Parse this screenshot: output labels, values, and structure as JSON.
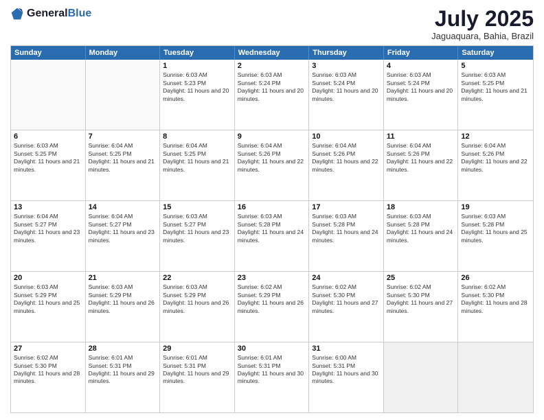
{
  "header": {
    "logo_general": "General",
    "logo_blue": "Blue",
    "month": "July 2025",
    "location": "Jaguaquara, Bahia, Brazil"
  },
  "day_headers": [
    "Sunday",
    "Monday",
    "Tuesday",
    "Wednesday",
    "Thursday",
    "Friday",
    "Saturday"
  ],
  "weeks": [
    [
      {
        "day": "",
        "info": "",
        "empty": true
      },
      {
        "day": "",
        "info": "",
        "empty": true
      },
      {
        "day": "1",
        "info": "Sunrise: 6:03 AM\nSunset: 5:23 PM\nDaylight: 11 hours and 20 minutes."
      },
      {
        "day": "2",
        "info": "Sunrise: 6:03 AM\nSunset: 5:24 PM\nDaylight: 11 hours and 20 minutes."
      },
      {
        "day": "3",
        "info": "Sunrise: 6:03 AM\nSunset: 5:24 PM\nDaylight: 11 hours and 20 minutes."
      },
      {
        "day": "4",
        "info": "Sunrise: 6:03 AM\nSunset: 5:24 PM\nDaylight: 11 hours and 20 minutes."
      },
      {
        "day": "5",
        "info": "Sunrise: 6:03 AM\nSunset: 5:25 PM\nDaylight: 11 hours and 21 minutes."
      }
    ],
    [
      {
        "day": "6",
        "info": "Sunrise: 6:03 AM\nSunset: 5:25 PM\nDaylight: 11 hours and 21 minutes."
      },
      {
        "day": "7",
        "info": "Sunrise: 6:04 AM\nSunset: 5:25 PM\nDaylight: 11 hours and 21 minutes."
      },
      {
        "day": "8",
        "info": "Sunrise: 6:04 AM\nSunset: 5:25 PM\nDaylight: 11 hours and 21 minutes."
      },
      {
        "day": "9",
        "info": "Sunrise: 6:04 AM\nSunset: 5:26 PM\nDaylight: 11 hours and 22 minutes."
      },
      {
        "day": "10",
        "info": "Sunrise: 6:04 AM\nSunset: 5:26 PM\nDaylight: 11 hours and 22 minutes."
      },
      {
        "day": "11",
        "info": "Sunrise: 6:04 AM\nSunset: 5:26 PM\nDaylight: 11 hours and 22 minutes."
      },
      {
        "day": "12",
        "info": "Sunrise: 6:04 AM\nSunset: 5:26 PM\nDaylight: 11 hours and 22 minutes."
      }
    ],
    [
      {
        "day": "13",
        "info": "Sunrise: 6:04 AM\nSunset: 5:27 PM\nDaylight: 11 hours and 23 minutes."
      },
      {
        "day": "14",
        "info": "Sunrise: 6:04 AM\nSunset: 5:27 PM\nDaylight: 11 hours and 23 minutes."
      },
      {
        "day": "15",
        "info": "Sunrise: 6:03 AM\nSunset: 5:27 PM\nDaylight: 11 hours and 23 minutes."
      },
      {
        "day": "16",
        "info": "Sunrise: 6:03 AM\nSunset: 5:28 PM\nDaylight: 11 hours and 24 minutes."
      },
      {
        "day": "17",
        "info": "Sunrise: 6:03 AM\nSunset: 5:28 PM\nDaylight: 11 hours and 24 minutes."
      },
      {
        "day": "18",
        "info": "Sunrise: 6:03 AM\nSunset: 5:28 PM\nDaylight: 11 hours and 24 minutes."
      },
      {
        "day": "19",
        "info": "Sunrise: 6:03 AM\nSunset: 5:28 PM\nDaylight: 11 hours and 25 minutes."
      }
    ],
    [
      {
        "day": "20",
        "info": "Sunrise: 6:03 AM\nSunset: 5:29 PM\nDaylight: 11 hours and 25 minutes."
      },
      {
        "day": "21",
        "info": "Sunrise: 6:03 AM\nSunset: 5:29 PM\nDaylight: 11 hours and 26 minutes."
      },
      {
        "day": "22",
        "info": "Sunrise: 6:03 AM\nSunset: 5:29 PM\nDaylight: 11 hours and 26 minutes."
      },
      {
        "day": "23",
        "info": "Sunrise: 6:02 AM\nSunset: 5:29 PM\nDaylight: 11 hours and 26 minutes."
      },
      {
        "day": "24",
        "info": "Sunrise: 6:02 AM\nSunset: 5:30 PM\nDaylight: 11 hours and 27 minutes."
      },
      {
        "day": "25",
        "info": "Sunrise: 6:02 AM\nSunset: 5:30 PM\nDaylight: 11 hours and 27 minutes."
      },
      {
        "day": "26",
        "info": "Sunrise: 6:02 AM\nSunset: 5:30 PM\nDaylight: 11 hours and 28 minutes."
      }
    ],
    [
      {
        "day": "27",
        "info": "Sunrise: 6:02 AM\nSunset: 5:30 PM\nDaylight: 11 hours and 28 minutes."
      },
      {
        "day": "28",
        "info": "Sunrise: 6:01 AM\nSunset: 5:31 PM\nDaylight: 11 hours and 29 minutes."
      },
      {
        "day": "29",
        "info": "Sunrise: 6:01 AM\nSunset: 5:31 PM\nDaylight: 11 hours and 29 minutes."
      },
      {
        "day": "30",
        "info": "Sunrise: 6:01 AM\nSunset: 5:31 PM\nDaylight: 11 hours and 30 minutes."
      },
      {
        "day": "31",
        "info": "Sunrise: 6:00 AM\nSunset: 5:31 PM\nDaylight: 11 hours and 30 minutes."
      },
      {
        "day": "",
        "info": "",
        "empty": true
      },
      {
        "day": "",
        "info": "",
        "empty": true
      }
    ]
  ]
}
